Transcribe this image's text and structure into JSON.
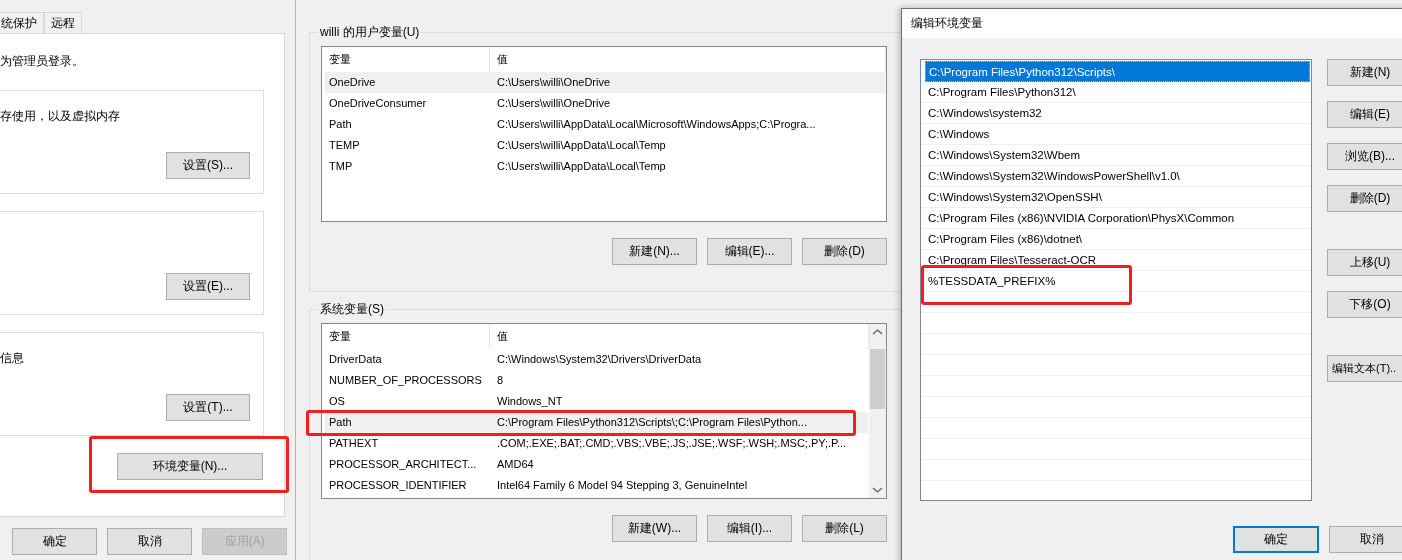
{
  "system_properties": {
    "tabs": [
      {
        "label": "统保护",
        "selected": false
      },
      {
        "label": "远程",
        "selected": false
      }
    ],
    "admin_note": "为管理员登录。",
    "groups": [
      {
        "description": "存使用，以及虚拟内存",
        "button": "设置(S)..."
      },
      {
        "button": "设置(E)..."
      },
      {
        "description": "信息",
        "button": "设置(T)..."
      }
    ],
    "env_button": {
      "label": "环境变量(N)...",
      "highlighted": true
    },
    "buttons": [
      {
        "label": "确定",
        "disabled": false
      },
      {
        "label": "取消",
        "disabled": false
      },
      {
        "label": "应用(A)",
        "disabled": true
      }
    ]
  },
  "environment_variables": {
    "user_variables": {
      "title": "willi 的用户变量(U)",
      "columns": [
        "变量",
        "值"
      ],
      "scrollbar": false,
      "rows": [
        {
          "cells": [
            "OneDrive",
            "C:\\Users\\willi\\OneDrive"
          ],
          "selected": true,
          "highlighted": false
        },
        {
          "cells": [
            "OneDriveConsumer",
            "C:\\Users\\willi\\OneDrive"
          ],
          "selected": false,
          "highlighted": false
        },
        {
          "cells": [
            "Path",
            "C:\\Users\\willi\\AppData\\Local\\Microsoft\\WindowsApps;C:\\Progra..."
          ],
          "selected": false,
          "highlighted": false
        },
        {
          "cells": [
            "TEMP",
            "C:\\Users\\willi\\AppData\\Local\\Temp"
          ],
          "selected": false,
          "highlighted": false
        },
        {
          "cells": [
            "TMP",
            "C:\\Users\\willi\\AppData\\Local\\Temp"
          ],
          "selected": false,
          "highlighted": false
        }
      ],
      "buttons": [
        "新建(N)...",
        "编辑(E)...",
        "删除(D)"
      ]
    },
    "system_variables": {
      "title": "系统变量(S)",
      "columns": [
        "变量",
        "值"
      ],
      "scrollbar": true,
      "rows": [
        {
          "cells": [
            "DriverData",
            "C:\\Windows\\System32\\Drivers\\DriverData"
          ],
          "selected": false,
          "highlighted": false
        },
        {
          "cells": [
            "NUMBER_OF_PROCESSORS",
            "8"
          ],
          "selected": false,
          "highlighted": false
        },
        {
          "cells": [
            "OS",
            "Windows_NT"
          ],
          "selected": false,
          "highlighted": false
        },
        {
          "cells": [
            "Path",
            "C:\\Program Files\\Python312\\Scripts\\;C:\\Program Files\\Python..."
          ],
          "selected": true,
          "highlighted": true
        },
        {
          "cells": [
            "PATHEXT",
            ".COM;.EXE;.BAT;.CMD;.VBS;.VBE;.JS;.JSE;.WSF;.WSH;.MSC;.PY;.P..."
          ],
          "selected": false,
          "highlighted": false
        },
        {
          "cells": [
            "PROCESSOR_ARCHITECT...",
            "AMD64"
          ],
          "selected": false,
          "highlighted": false
        },
        {
          "cells": [
            "PROCESSOR_IDENTIFIER",
            "Intel64 Family 6 Model 94 Stepping 3, GenuineIntel"
          ],
          "selected": false,
          "highlighted": false
        }
      ],
      "buttons": [
        "新建(W)...",
        "编辑(I)...",
        "删除(L)"
      ]
    }
  },
  "edit_dialog": {
    "title": "编辑环境变量",
    "items": [
      {
        "text": "C:\\Program Files\\Python312\\Scripts\\",
        "selected": true,
        "highlighted": false
      },
      {
        "text": "C:\\Program Files\\Python312\\",
        "selected": false,
        "highlighted": false
      },
      {
        "text": "C:\\Windows\\system32",
        "selected": false,
        "highlighted": false
      },
      {
        "text": "C:\\Windows",
        "selected": false,
        "highlighted": false
      },
      {
        "text": "C:\\Windows\\System32\\Wbem",
        "selected": false,
        "highlighted": false
      },
      {
        "text": "C:\\Windows\\System32\\WindowsPowerShell\\v1.0\\",
        "selected": false,
        "highlighted": false
      },
      {
        "text": "C:\\Windows\\System32\\OpenSSH\\",
        "selected": false,
        "highlighted": false
      },
      {
        "text": "C:\\Program Files (x86)\\NVIDIA Corporation\\PhysX\\Common",
        "selected": false,
        "highlighted": false
      },
      {
        "text": "C:\\Program Files (x86)\\dotnet\\",
        "selected": false,
        "highlighted": false
      },
      {
        "text": "C:\\Program Files\\Tesseract-OCR",
        "selected": false,
        "highlighted": false
      },
      {
        "text": "%TESSDATA_PREFIX%",
        "selected": false,
        "highlighted": true
      }
    ],
    "button_groups": [
      [
        "新建(N)",
        "编辑(E)",
        "浏览(B)...",
        "删除(D)"
      ],
      [
        "上移(U)",
        "下移(O)"
      ],
      [
        "编辑文本(T).."
      ]
    ],
    "footer_buttons": [
      {
        "label": "确定",
        "default": true
      },
      {
        "label": "取消",
        "default": false
      }
    ]
  }
}
